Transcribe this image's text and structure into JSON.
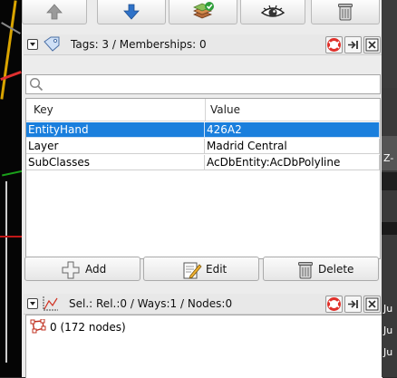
{
  "toolbar": {
    "buttons": [
      {
        "name": "move-up-button",
        "icon": "up-arrow-icon"
      },
      {
        "name": "move-down-button",
        "icon": "down-arrow-icon"
      },
      {
        "name": "layers-button",
        "icon": "layers-check-icon"
      },
      {
        "name": "visibility-button",
        "icon": "eye-icon"
      },
      {
        "name": "trash-button",
        "icon": "trash-icon"
      }
    ]
  },
  "tags_panel": {
    "title": "Tags: 3 / Memberships: 0",
    "search": {
      "placeholder": "",
      "value": ""
    },
    "columns": {
      "key": "Key",
      "value": "Value"
    },
    "rows": [
      {
        "key": "EntityHand",
        "value": "426A2",
        "selected": true
      },
      {
        "key": "Layer",
        "value": "Madrid Central",
        "selected": false
      },
      {
        "key": "SubClasses",
        "value": "AcDbEntity:AcDbPolyline",
        "selected": false
      }
    ],
    "actions": {
      "add": "Add",
      "edit": "Edit",
      "delete": "Delete"
    }
  },
  "selection_panel": {
    "title": "Sel.: Rel.:0 / Ways:1 / Nodes:0",
    "items": [
      {
        "label": "0 (172 nodes)",
        "icon": "way-icon"
      }
    ]
  },
  "right_strip": {
    "texts": [
      "Z-",
      "Ju",
      "Ju",
      "Ju"
    ]
  },
  "colors": {
    "selection": "#1a7fdd",
    "help_icon": "#e0302a"
  }
}
